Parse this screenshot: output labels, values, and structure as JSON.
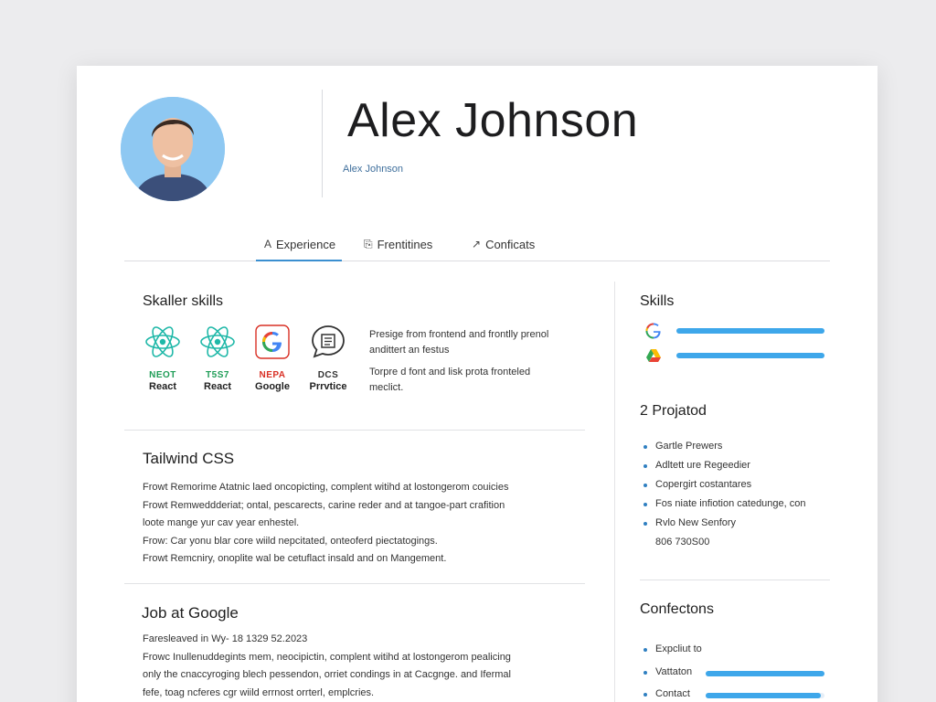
{
  "profile": {
    "name": "Alex Johnson",
    "subtitle": "Alex Johnson"
  },
  "tabs": [
    {
      "icon": "A",
      "label": "Experience",
      "active": true
    },
    {
      "icon": "⎘",
      "label": "Frentitines",
      "active": false
    },
    {
      "icon": "↗",
      "label": "Conficats",
      "active": false
    }
  ],
  "skills_section": {
    "title": "Skaller skills",
    "tiles": [
      {
        "code": "NEOT",
        "label": "React",
        "icon": "react-icon",
        "code_color": "#1f9d57"
      },
      {
        "code": "T5S7",
        "label": "React",
        "icon": "react-icon",
        "code_color": "#1f9d57"
      },
      {
        "code": "NEPA",
        "label": "Google",
        "icon": "google-icon",
        "code_color": "#d93025"
      },
      {
        "code": "DCS",
        "label": "Prrvtice",
        "icon": "chat-icon",
        "code_color": "#333333"
      }
    ],
    "desc_1a": "Presige from frontend and frontlly prenol",
    "desc_1b": "andittert an festus",
    "desc_2a": "Torpre d font and lisk prota fronteled",
    "desc_2b": "meclict."
  },
  "tailwind_section": {
    "title": "Tailwind CSS",
    "lines": [
      "Frowt Remorime Atatnic laed oncopicting, complent witihd at lostongerom couicies",
      "Frowt Remweddderiat; ontal, pescarects, carine reder and at tangoe-part crafition",
      "loote mange yur cav year enhestel.",
      "Frow: Car yonu blar core wiild nepcitated, onteoferd piectatogings.",
      "Frowt Remcniry, onoplite wal be cetuflact insald and on Mangement."
    ]
  },
  "job_section": {
    "title": "Job at Google",
    "lines": [
      "Faresleaved in Wy- 18 1329 52.2023",
      "Frowc Inullenuddegints mem, neocipictin, complent witihd at lostongerom pealicing",
      "only the cnaccyroging blech pessendon, orriet condings in at Cacgnge. and Ifermal",
      "fefe, toag ncferes cgr wiild errnost orrterl, emplcries."
    ]
  },
  "right_skills": {
    "title": "Skills",
    "bars": [
      {
        "icon": "google-icon",
        "level": 1.0
      },
      {
        "icon": "drive-icon",
        "level": 1.0
      }
    ]
  },
  "projects": {
    "title": "2 Projatod",
    "items": [
      "Gartle Prewers",
      "Adltett ure Regeedier",
      "Copergirt costantares",
      "Fos niate infiotion catedunge, con",
      "Rvlo New Senfory",
      "806 730S00"
    ]
  },
  "connections": {
    "title": "Confectons",
    "items": [
      {
        "label": "Expcliut to",
        "bar": null
      },
      {
        "label": "Vattaton",
        "bar": 1.0
      },
      {
        "label": "Contact",
        "bar": 0.97
      }
    ]
  },
  "colors": {
    "accent": "#3a8fd0",
    "bar": "#3ea7ea"
  }
}
